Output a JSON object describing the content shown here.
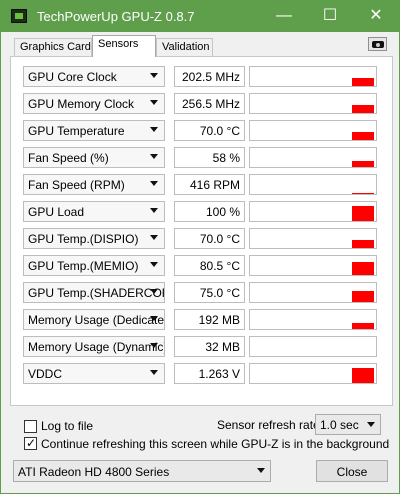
{
  "window": {
    "title": "TechPowerUp GPU-Z 0.8.7",
    "controls": {
      "minimize": "—",
      "maximize": "☐",
      "close": "✕"
    },
    "title_bar_color": "#5f9f4c"
  },
  "tabs": [
    {
      "label": "Graphics Card",
      "active": false
    },
    {
      "label": "Sensors",
      "active": true
    },
    {
      "label": "Validation",
      "active": false
    }
  ],
  "icons": {
    "app": "gpu-z-icon",
    "camera": "camera-icon",
    "dropdown": "dropdown-arrow-icon"
  },
  "sensors": [
    {
      "name": "GPU Core Clock",
      "value": "202.5 MHz",
      "graph_level": 0.48
    },
    {
      "name": "GPU Memory Clock",
      "value": "256.5 MHz",
      "graph_level": 0.48
    },
    {
      "name": "GPU Temperature",
      "value": "70.0 °C",
      "graph_level": 0.48
    },
    {
      "name": "Fan Speed (%)",
      "value": "58 %",
      "graph_level": 0.38
    },
    {
      "name": "Fan Speed (RPM)",
      "value": "416 RPM",
      "graph_level": 0.1
    },
    {
      "name": "GPU Load",
      "value": "100 %",
      "graph_level": 0.86
    },
    {
      "name": "GPU Temp.(DISPIO)",
      "value": "70.0 °C",
      "graph_level": 0.48
    },
    {
      "name": "GPU Temp.(MEMIO)",
      "value": "80.5 °C",
      "graph_level": 0.72
    },
    {
      "name": "GPU Temp.(SHADERCORE)",
      "value": "75.0 °C",
      "graph_level": 0.62
    },
    {
      "name": "Memory Usage (Dedicated)",
      "value": "192 MB",
      "graph_level": 0.38
    },
    {
      "name": "Memory Usage (Dynamic)",
      "value": "32 MB",
      "graph_level": 0.05
    },
    {
      "name": "VDDC",
      "value": "1.263 V",
      "graph_level": 0.86
    }
  ],
  "graph_color": "#ff0000",
  "footer": {
    "log_to_file": "Log to file",
    "log_to_file_checked": false,
    "refresh_rate_label": "Sensor refresh rate:",
    "refresh_rate_value": "1.0 sec",
    "continue_refreshing": "Continue refreshing this screen while GPU-Z is in the background",
    "continue_refreshing_checked": true,
    "gpu_select_value": "ATI Radeon HD 4800 Series",
    "close_label": "Close"
  }
}
